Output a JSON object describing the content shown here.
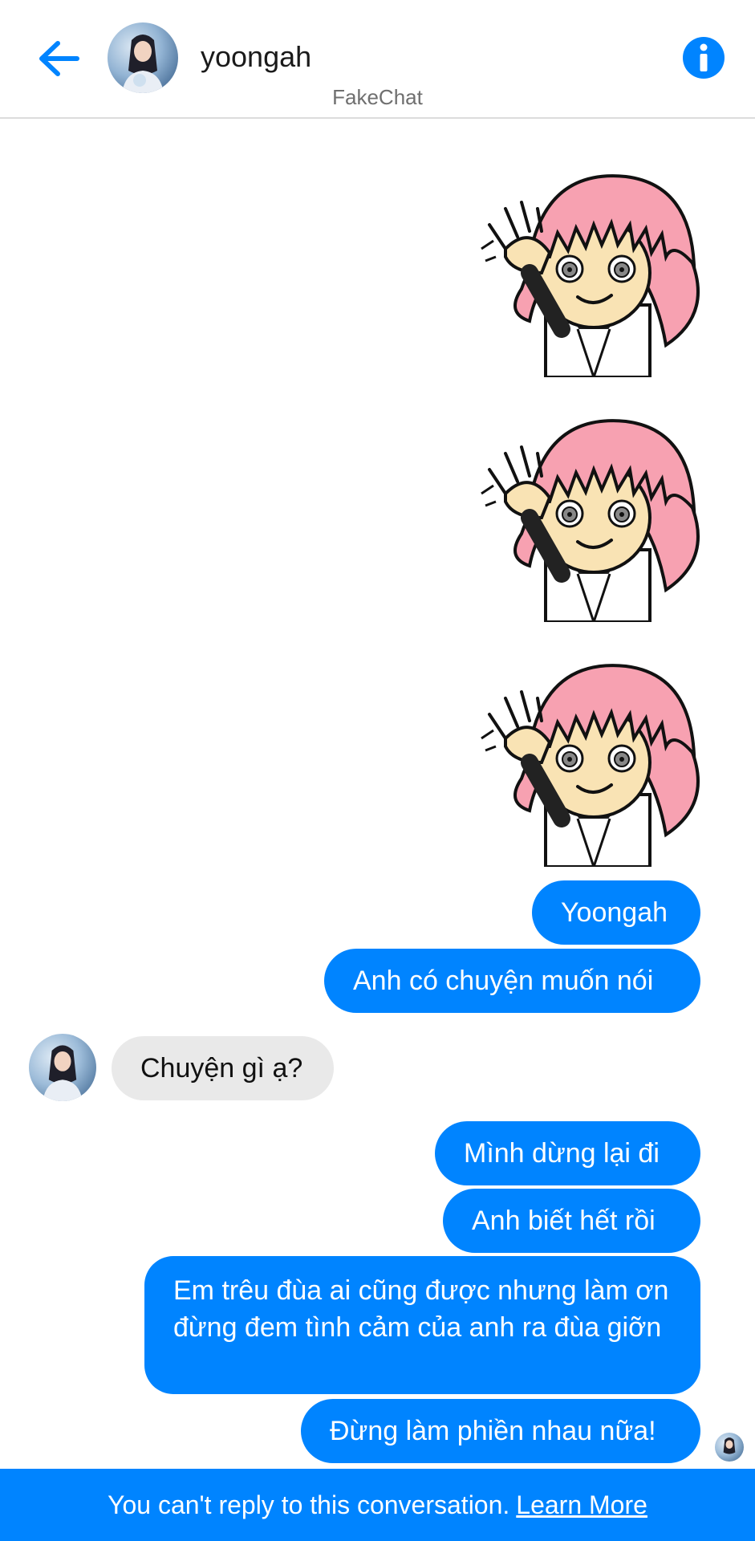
{
  "header": {
    "contact_name": "yoongah",
    "app_label": "FakeChat",
    "back_icon": "arrow-left-icon",
    "info_icon": "info-icon",
    "accent_color": "#0084ff"
  },
  "messages": [
    {
      "sender": "me",
      "type": "sticker",
      "sticker": "pink-hair-girl-waving"
    },
    {
      "sender": "me",
      "type": "sticker",
      "sticker": "pink-hair-girl-waving"
    },
    {
      "sender": "me",
      "type": "sticker",
      "sticker": "pink-hair-girl-waving"
    },
    {
      "sender": "me",
      "type": "text",
      "text": "Yoongah"
    },
    {
      "sender": "me",
      "type": "text",
      "text": "Anh có chuyện muốn nói"
    },
    {
      "sender": "them",
      "type": "text",
      "text": "Chuyện gì ạ?"
    },
    {
      "sender": "me",
      "type": "text",
      "text": "Mình dừng lại đi"
    },
    {
      "sender": "me",
      "type": "text",
      "text": "Anh biết hết rồi"
    },
    {
      "sender": "me",
      "type": "text",
      "text": "Em trêu đùa ai cũng được nhưng làm ơn đừng đem tình cảm của anh ra đùa giỡn"
    },
    {
      "sender": "me",
      "type": "text",
      "text": "Đừng làm phiền nhau nữa!"
    }
  ],
  "footer": {
    "notice": "You can't reply to this conversation.",
    "link": "Learn More"
  },
  "colors": {
    "outgoing_bubble": "#0084ff",
    "incoming_bubble": "#e9e9e9",
    "footer_bg": "#0084ff"
  }
}
